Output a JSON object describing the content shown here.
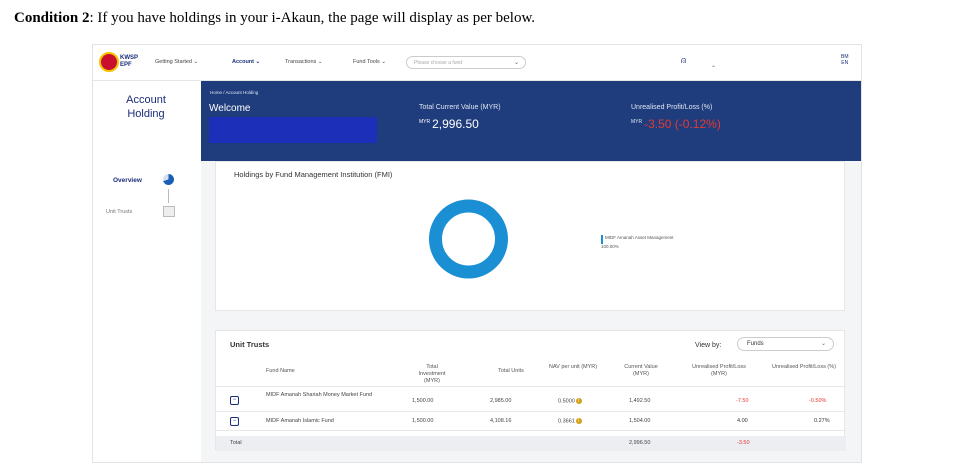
{
  "caption": {
    "label": "Condition 2",
    "text": ": If you have holdings in your i-Akaun, the page will display as per below."
  },
  "header": {
    "logo_line1": "KWSP",
    "logo_line2": "EPF",
    "nav": [
      "Getting Started",
      "Account",
      "Transactions",
      "Fund Tools"
    ],
    "fund_select_placeholder": "Please choose a fund",
    "lang_line1": "BM",
    "lang_line2": "EN"
  },
  "sidebar": {
    "title": "Account Holding",
    "overview": "Overview",
    "unit_trusts": "Unit Trusts"
  },
  "banner": {
    "breadcrumb": "Home / Account Holding",
    "welcome": "Welcome",
    "tcv_label": "Total Current Value (MYR)",
    "tcv_currency": "MYR",
    "tcv_value": "2,996.50",
    "upl_label": "Unrealised Profit/Loss (%)",
    "upl_currency": "MYR",
    "upl_value": "-3.50 (-0.12%)"
  },
  "holdings": {
    "title": "Holdings by Fund Management Institution (FMI)",
    "legend": "MIDF Amanah Asset Management 100.00%"
  },
  "chart_data": {
    "type": "pie",
    "categories": [
      "MIDF Amanah Asset Management"
    ],
    "values": [
      100.0
    ],
    "title": "Holdings by Fund Management Institution (FMI)"
  },
  "unit_trusts": {
    "title": "Unit Trusts",
    "view_by_label": "View by:",
    "view_by_value": "Funds",
    "headers": {
      "fund_name": "Fund Name",
      "total_investment": "Total Investment (MYR)",
      "total_units": "Total Units",
      "nav": "NAV per unit (MYR)",
      "current_value": "Current Value (MYR)",
      "upl_myr": "Unrealised Profit/Loss (MYR)",
      "upl_pct": "Unrealised Profit/Loss (%)"
    },
    "rows": [
      {
        "name": "MIDF Amanah Shariah Money Market Fund",
        "investment": "1,500.00",
        "units": "2,985.00",
        "nav": "0.5000",
        "current": "1,492.50",
        "upl_myr": "-7.50",
        "upl_pct": "-0.50%"
      },
      {
        "name": "MIDF Amanah Islamic Fund",
        "investment": "1,500.00",
        "units": "4,108.16",
        "nav": "0.3661",
        "current": "1,504.00",
        "upl_myr": "4.00",
        "upl_pct": "0.27%"
      }
    ],
    "total_label": "Total",
    "total_current": "2,996.50",
    "total_upl_myr": "-3.50"
  },
  "colors": {
    "primary": "#1f3d7c",
    "donut": "#1a8fd4",
    "negative": "#e53935"
  }
}
